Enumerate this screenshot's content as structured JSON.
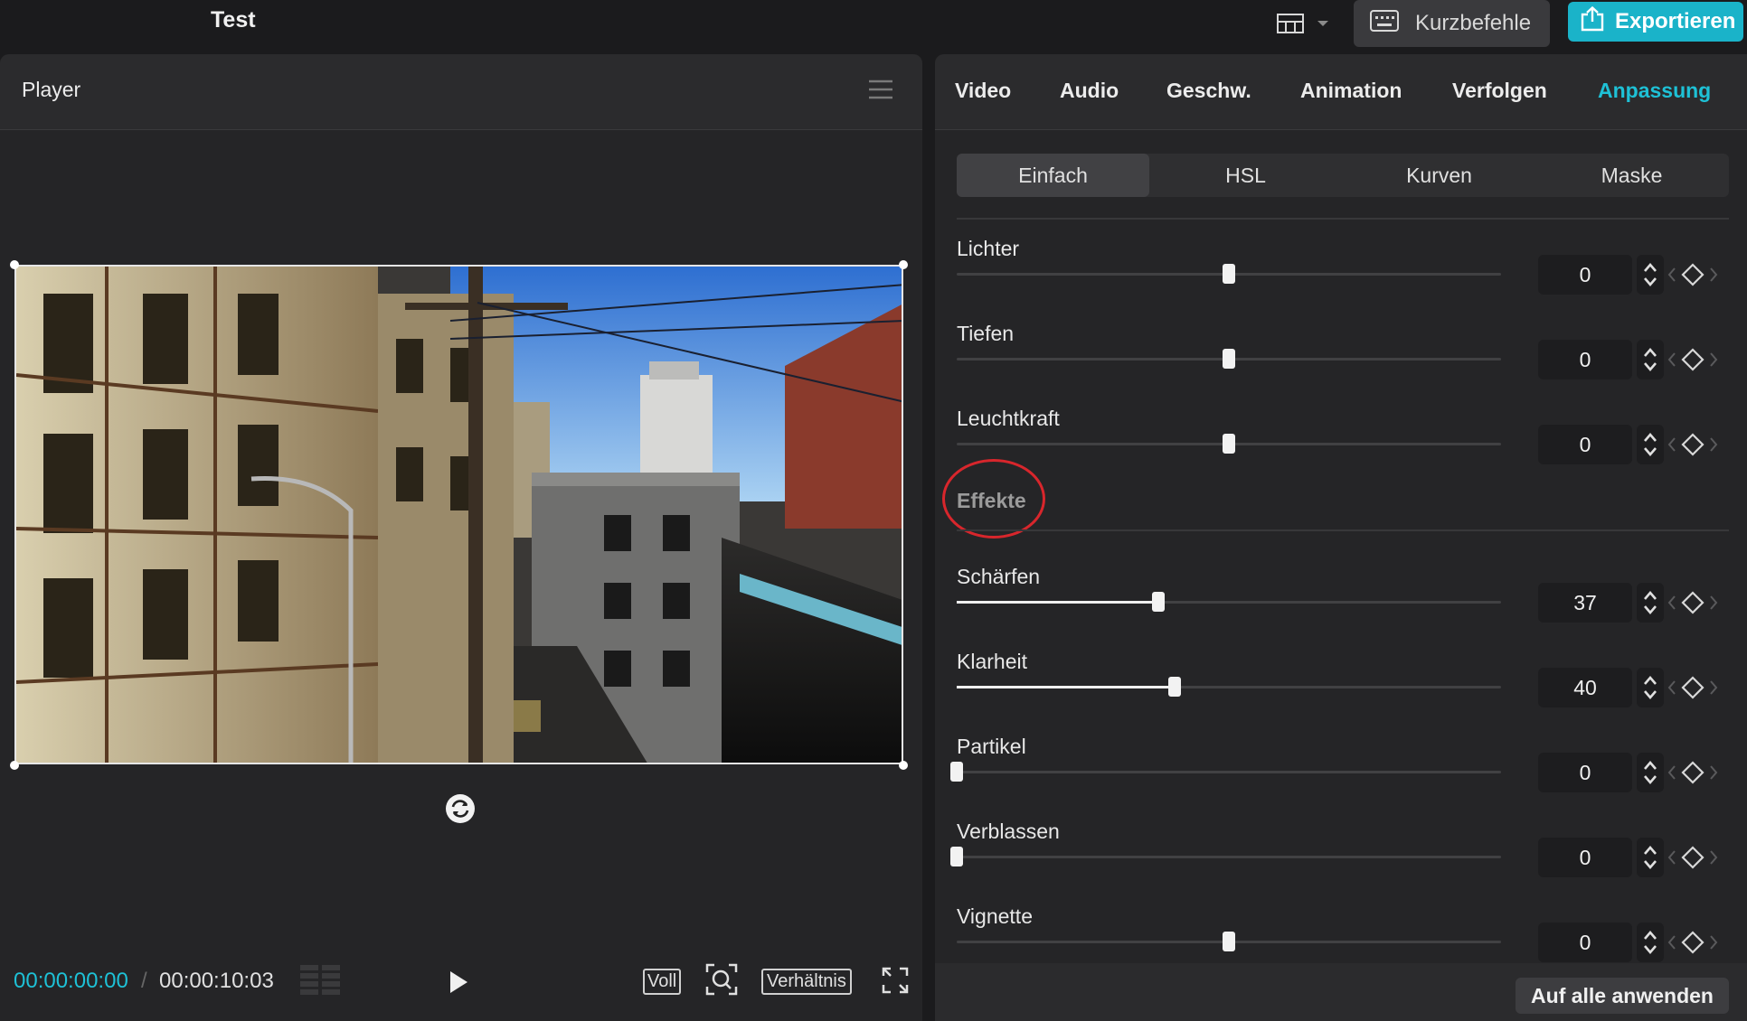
{
  "project": {
    "title": "Test"
  },
  "toolbar": {
    "shortcuts_label": "Kurzbefehle",
    "export_label": "Exportieren",
    "export_color": "#1ab3c9"
  },
  "player": {
    "title": "Player",
    "current_time": "00:00:00:00",
    "separator": "/",
    "total_time": "00:00:10:03",
    "voll_label": "Voll",
    "ratio_label": "Verhältnis"
  },
  "inspector": {
    "tabs": [
      "Video",
      "Audio",
      "Geschw.",
      "Animation",
      "Verfolgen",
      "Anpassung"
    ],
    "active_tab": "Anpassung",
    "sub_tabs": [
      "Einfach",
      "HSL",
      "Kurven",
      "Maske"
    ],
    "active_sub_tab": "Einfach",
    "accent_color": "#1ec1d6",
    "sliders_top": [
      {
        "label": "Lichter",
        "value": "0",
        "fraction": 0.5
      },
      {
        "label": "Tiefen",
        "value": "0",
        "fraction": 0.5
      },
      {
        "label": "Leuchtkraft",
        "value": "0",
        "fraction": 0.5
      }
    ],
    "effects_heading": "Effekte",
    "highlight_color": "#d8262c",
    "sliders_effects": [
      {
        "label": "Schärfen",
        "value": "37",
        "fraction": 0.37
      },
      {
        "label": "Klarheit",
        "value": "40",
        "fraction": 0.4
      },
      {
        "label": "Partikel",
        "value": "0",
        "fraction": 0.0
      },
      {
        "label": "Verblassen",
        "value": "0",
        "fraction": 0.0
      },
      {
        "label": "Vignette",
        "value": "0",
        "fraction": 0.5
      }
    ],
    "apply_all_label": "Auf alle anwenden"
  }
}
